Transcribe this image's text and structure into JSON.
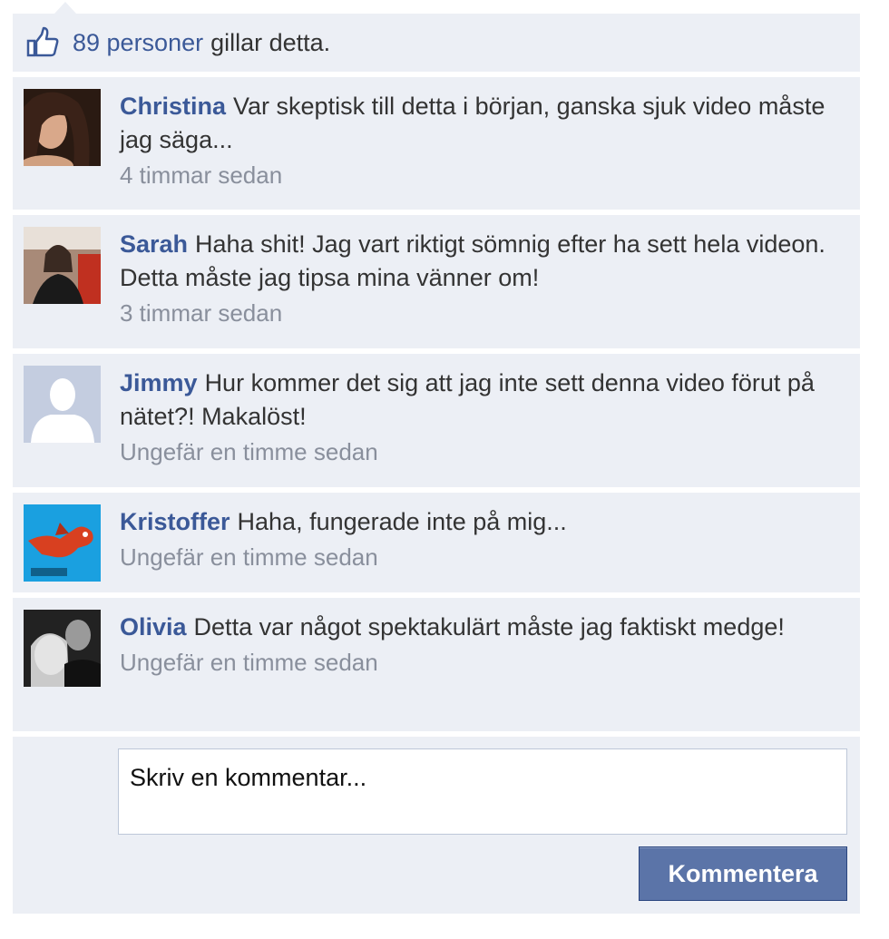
{
  "likes": {
    "count_text": "89 personer",
    "rest_text": "gillar detta."
  },
  "comments": [
    {
      "name": "Christina",
      "text": "Var skeptisk till detta i början, ganska sjuk video måste jag säga...",
      "time": "4 timmar sedan",
      "avatar": "profile-photo-woman"
    },
    {
      "name": "Sarah",
      "text": "Haha shit! Jag vart riktigt sömnig efter ha sett hela videon. Detta måste jag tipsa mina vänner om!",
      "time": "3 timmar sedan",
      "avatar": "profile-photo-woman-indoor"
    },
    {
      "name": "Jimmy",
      "text": "Hur kommer det sig att jag inte sett denna video förut på nätet?! Makalöst!",
      "time": "Ungefär en timme sedan",
      "avatar": "default-silhouette"
    },
    {
      "name": "Kristoffer",
      "text": "Haha, fungerade inte på mig...",
      "time": "Ungefär en timme sedan",
      "avatar": "dragon-cartoon"
    },
    {
      "name": "Olivia",
      "text": "Detta var något spektakulärt måste jag faktiskt medge!",
      "time": "Ungefär en timme sedan",
      "avatar": "profile-photo-couple-bw"
    }
  ],
  "reply": {
    "placeholder": "Skriv en kommentar...",
    "button_label": "Kommentera"
  },
  "colors": {
    "link": "#3b5998",
    "panel_bg": "#eceff5",
    "timestamp": "#898f9c",
    "button_bg": "#5b74a8"
  }
}
